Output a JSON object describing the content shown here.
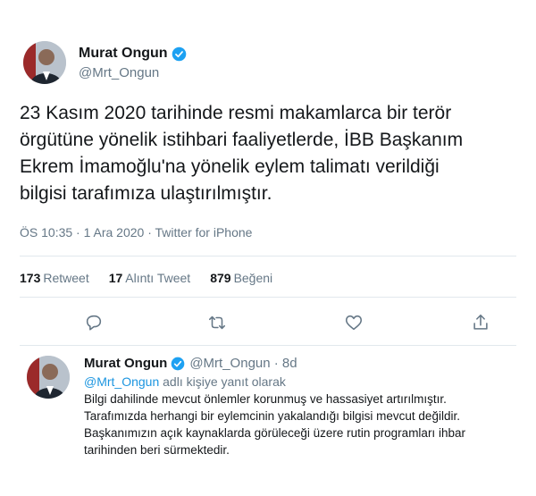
{
  "main_tweet": {
    "display_name": "Murat Ongun",
    "handle": "@Mrt_Ongun",
    "text_lines": [
      "23 Kasım 2020 tarihinde resmi makamlarca bir terör",
      "örgütüne yönelik istihbari faaliyetlerde, İBB Başkanım",
      "Ekrem İmamoğlu'na yönelik eylem talimatı verildiği",
      "bilgisi tarafımıza ulaştırılmıştır."
    ],
    "meta": "ÖS 10:35 · 1 Ara 2020 · Twitter for iPhone",
    "stats": {
      "retweet_count": "173",
      "retweet_label": "Retweet",
      "quote_count": "17",
      "quote_label": "Alıntı Tweet",
      "like_count": "879",
      "like_label": "Beğeni"
    },
    "actions": [
      "reply-icon",
      "retweet-icon",
      "like-icon",
      "share-icon"
    ]
  },
  "reply_tweet": {
    "display_name": "Murat Ongun",
    "handle_time": "@Mrt_Ongun · 8d",
    "reply_to_mention": "@Mrt_Ongun",
    "reply_to_suffix": " adlı kişiye yanıt olarak",
    "text_lines": [
      "Bilgi dahilinde mevcut önlemler korunmuş ve hassasiyet artırılmıştır.",
      "Tarafımızda herhangi bir eylemcinin yakalandığı bilgisi mevcut değildir.",
      "Başkanımızın açık kaynaklarda görüleceği üzere rutin programları ihbar",
      "tarihinden beri sürmektedir."
    ]
  },
  "colors": {
    "accent": "#1da1f2",
    "secondary_text": "#657786",
    "divider": "#e1e8ed"
  }
}
